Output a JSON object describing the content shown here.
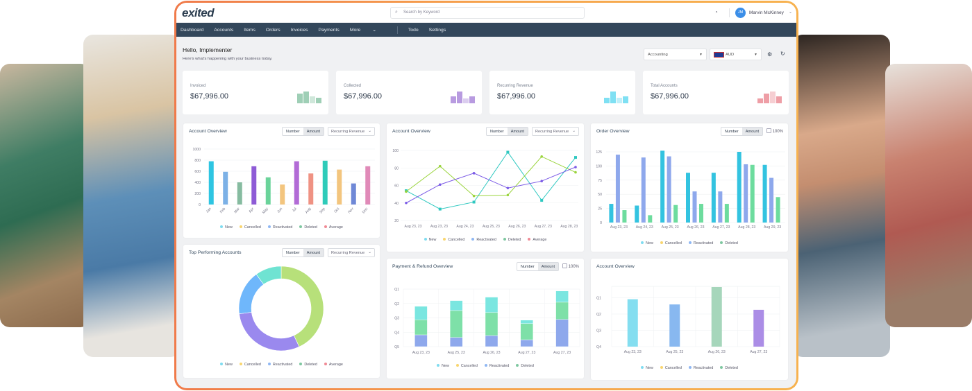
{
  "header": {
    "logo_text": "exited",
    "search_placeholder": "Search by Keyword",
    "user_initials": "JM",
    "user_name": "Marvin McKinney"
  },
  "nav": [
    "Dashboard",
    "Accounts",
    "Items",
    "Orders",
    "Invoices",
    "Payments",
    "More",
    "Todo",
    "Settings"
  ],
  "greeting": {
    "title": "Hello, Implementer",
    "subtitle": "Here's what's happening with your business today."
  },
  "filters": {
    "department": "Accounting",
    "currency": "AUD"
  },
  "cards": [
    {
      "label": "Invoiced",
      "value": "$67,996.00",
      "color": "#9fcfb6",
      "spark": [
        0.8,
        1,
        0.6,
        0.5
      ]
    },
    {
      "label": "Collected",
      "value": "$67,996.00",
      "color": "#b89be0",
      "spark": [
        0.6,
        1,
        0.4,
        0.6
      ]
    },
    {
      "label": "Recurring Revenue",
      "value": "$67,996.00",
      "color": "#7fe0f3",
      "spark": [
        0.45,
        1,
        0.45,
        0.6
      ]
    },
    {
      "label": "Total Accounts",
      "value": "$67,996.00",
      "color": "#ee9ea6",
      "spark": [
        0.4,
        0.8,
        1,
        0.6
      ]
    }
  ],
  "controls": {
    "number": "Number",
    "amount": "Amount",
    "metric": "Recurring Revenue",
    "percent": "100%"
  },
  "legend_colors": {
    "New": "#7fdcf0",
    "Cancelled": "#f9d56e",
    "Reactivated": "#8fb7f3",
    "Deleted": "#7ec7a0",
    "Average": "#f08a95"
  },
  "panels": {
    "p1": {
      "title": "Account Overview",
      "legend": [
        "New",
        "Cancelled",
        "Reactivated",
        "Deleted",
        "Average"
      ]
    },
    "p2": {
      "title": "Account Overview",
      "legend": [
        "New",
        "Cancelled",
        "Reactivated",
        "Deleted",
        "Average"
      ]
    },
    "p3": {
      "title": "Order Overview",
      "legend": [
        "New",
        "Cancelled",
        "Reactivated",
        "Deleted"
      ]
    },
    "p4": {
      "title": "Top Performing Accounts",
      "legend": [
        "New",
        "Cancelled",
        "Reactivated",
        "Deleted",
        "Average"
      ]
    },
    "p5": {
      "title": "Payment & Refund Overview",
      "legend": [
        "New",
        "Cancelled",
        "Reactivated",
        "Deleted"
      ]
    },
    "p6": {
      "title": "Account Overview",
      "legend": [
        "New",
        "Cancelled",
        "Reactivated",
        "Deleted"
      ]
    }
  },
  "chart_data": [
    {
      "type": "bar",
      "categories": [
        "Jan",
        "Feb",
        "Mar",
        "Apr",
        "May",
        "Jun",
        "Jul",
        "Aug",
        "Sep",
        "Oct",
        "Nov",
        "Dec"
      ],
      "values": [
        780,
        590,
        400,
        690,
        490,
        360,
        780,
        560,
        790,
        630,
        380,
        690
      ],
      "colors": [
        "#2ec5e2",
        "#7cb1e6",
        "#86bba0",
        "#8e5bd6",
        "#6ad39a",
        "#f3c57e",
        "#b26bd6",
        "#ef9283",
        "#2ecbb9",
        "#f3c57e",
        "#6f88d6",
        "#e08ab8"
      ],
      "ylim": [
        0,
        1000
      ],
      "yticks": [
        0,
        200,
        400,
        600,
        800,
        1000
      ],
      "grid": true
    },
    {
      "type": "line",
      "x_labels": [
        "Aug 23, 23",
        "Aug 23, 23",
        "Aug 24, 23",
        "Aug 25, 23",
        "Aug 26, 23",
        "Aug 27, 23",
        "Aug 28, 23"
      ],
      "series": [
        {
          "color": "#2ec8c0",
          "values": [
            54,
            33,
            41,
            98,
            43,
            92
          ]
        },
        {
          "color": "#9ad43c",
          "values": [
            53,
            82,
            48,
            49,
            93,
            75
          ]
        },
        {
          "color": "#7b5be6",
          "values": [
            40,
            61,
            74,
            57,
            65,
            81
          ]
        }
      ],
      "ylim": [
        20,
        100
      ],
      "yticks": [
        20,
        40,
        60,
        80,
        100
      ],
      "grid": true
    },
    {
      "type": "bar",
      "categories": [
        "Aug 23, 23",
        "Aug 24, 23",
        "Aug 25, 23",
        "Aug 26, 23",
        "Aug 27, 23",
        "Aug 28, 23",
        "Aug 29, 23"
      ],
      "series": [
        {
          "color": "#33c3e0",
          "values": [
            33,
            30,
            127,
            88,
            88,
            125,
            102
          ]
        },
        {
          "color": "#8ea8ec",
          "values": [
            120,
            115,
            117,
            55,
            55,
            103,
            79
          ]
        },
        {
          "color": "#6ddc9e",
          "values": [
            22,
            13,
            31,
            33,
            33,
            102,
            45
          ]
        }
      ],
      "ylim": [
        0,
        125
      ],
      "yticks": [
        0,
        25,
        50,
        75,
        100,
        125
      ],
      "grid": true
    },
    {
      "type": "pie",
      "slices": [
        {
          "color": "#b7e07a",
          "value": 0.43
        },
        {
          "color": "#9a89ee",
          "value": 0.3
        },
        {
          "color": "#6fb7fb",
          "value": 0.17
        },
        {
          "color": "#6fe3d2",
          "value": 0.1
        }
      ]
    },
    {
      "type": "bar",
      "stacked": true,
      "categories": [
        "Aug 23, 23",
        "Aug 25, 23",
        "Aug 26, 23",
        "Aug 27, 23",
        "Aug 27, 23"
      ],
      "y_labels": [
        "Q5",
        "Q4",
        "Q3",
        "Q2",
        "Q1"
      ],
      "ylim": [
        0,
        4
      ],
      "series": [
        {
          "name": "Reactivated",
          "color": "#8ea8ec",
          "values": [
            0.82,
            0.64,
            0.77,
            0.48,
            1.89
          ]
        },
        {
          "name": "Deleted",
          "color": "#7ee0a8",
          "values": [
            1.05,
            1.87,
            1.6,
            1.12,
            1.2
          ]
        },
        {
          "name": "New",
          "color": "#7ae6e0",
          "values": [
            0.93,
            0.69,
            1.07,
            0.24,
            0.78
          ]
        }
      ],
      "grid": true
    },
    {
      "type": "bar",
      "categories": [
        "Aug 23, 23",
        "Aug 25, 23",
        "Aug 26, 23",
        "Aug 27, 23"
      ],
      "y_labels": [
        "Q4",
        "Q3",
        "Q2",
        "Q1"
      ],
      "ylim": [
        0,
        3.7
      ],
      "values": [
        2.91,
        2.59,
        3.66,
        2.26
      ],
      "colors": [
        "#84def0",
        "#88b8f0",
        "#a6d6bb",
        "#ab8de6"
      ],
      "grid": true
    }
  ]
}
